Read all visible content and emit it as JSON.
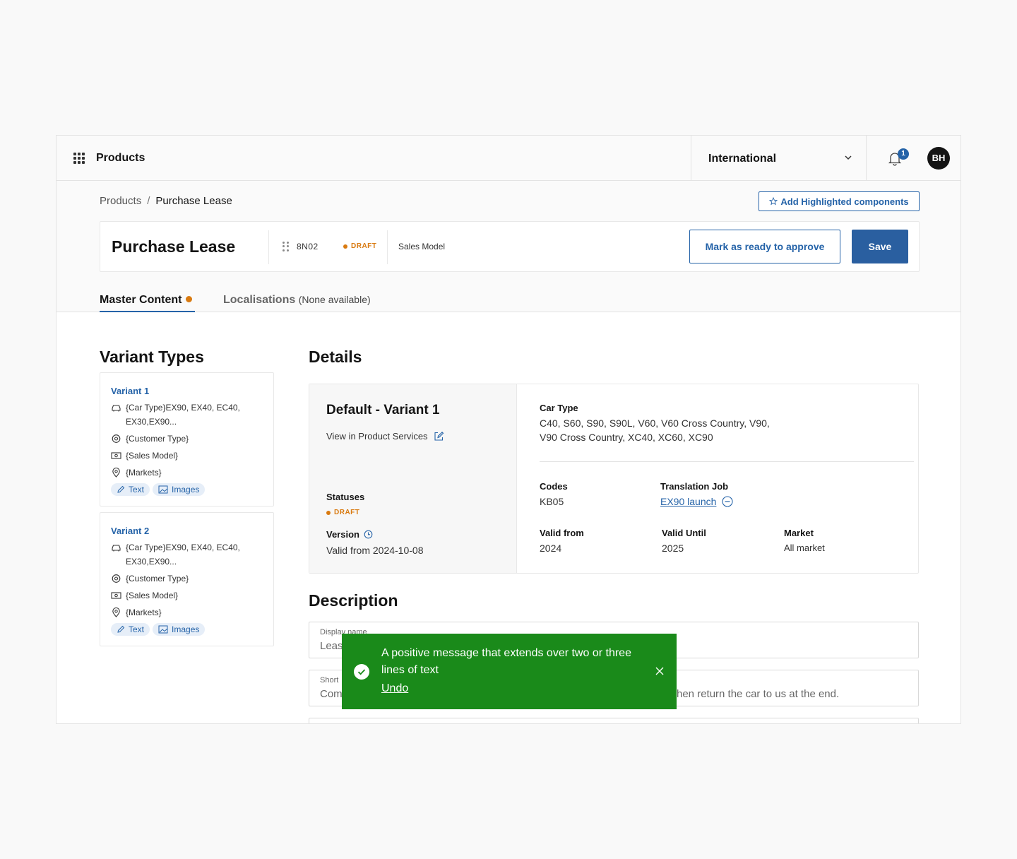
{
  "topbar": {
    "app_title": "Products",
    "market": "International",
    "notification_count": "1",
    "avatar_initials": "BH"
  },
  "breadcrumb": {
    "root": "Products",
    "separator": "/",
    "current": "Purchase Lease"
  },
  "header": {
    "add_highlight_label": "Add Highlighted components",
    "page_title": "Purchase Lease",
    "code": "8N02",
    "status": "DRAFT",
    "sales_model": "Sales Model",
    "ready_label": "Mark as ready to approve",
    "save_label": "Save"
  },
  "tabs": {
    "master": "Master Content",
    "localisations": "Localisations",
    "localisations_sub": "(None available)"
  },
  "variant_types": {
    "title": "Variant Types",
    "items": [
      {
        "name": "Variant 1",
        "car_type": "{Car Type}EX90, EX40, EC40, EX30,EX90...",
        "customer_type": "{Customer Type}",
        "sales_model": "{Sales Model}",
        "markets": "{Markets}",
        "chip_text": "Text",
        "chip_images": "Images"
      },
      {
        "name": "Variant 2",
        "car_type": "{Car Type}EX90, EX40, EC40, EX30,EX90...",
        "customer_type": "{Customer Type}",
        "sales_model": "{Sales Model}",
        "markets": "{Markets}",
        "chip_text": "Text",
        "chip_images": "Images"
      }
    ]
  },
  "details": {
    "title": "Details",
    "variant_title": "Default - Variant 1",
    "view_link": "View in Product Services",
    "statuses_label": "Statuses",
    "status": "DRAFT",
    "version_label": "Version",
    "version_value": "Valid from 2024-10-08",
    "car_type_label": "Car Type",
    "car_type_line1": "C40, S60, S90, S90L, V60, V60 Cross Country, V90,",
    "car_type_line2": "V90 Cross Country, XC40, XC60, XC90",
    "codes_label": "Codes",
    "codes_value": "KB05",
    "translation_label": "Translation Job",
    "translation_value": "EX90 launch",
    "valid_from_label": "Valid from",
    "valid_from_value": "2024",
    "valid_until_label": "Valid Until",
    "valid_until_value": "2025",
    "market_label": "Market",
    "market_value": "All market"
  },
  "description": {
    "title": "Description",
    "display_name_label": "Display name",
    "display_name_value": "Leas",
    "short_label": "Short",
    "short_value_start": "Com",
    "short_value_end": "hen return the car to us at the end."
  },
  "toast": {
    "message": "A positive message that extends over two or three lines of text",
    "undo_label": "Undo"
  },
  "colors": {
    "accent": "#2563a8",
    "draft": "#d97a10",
    "toast_bg": "#1a8a1a"
  }
}
